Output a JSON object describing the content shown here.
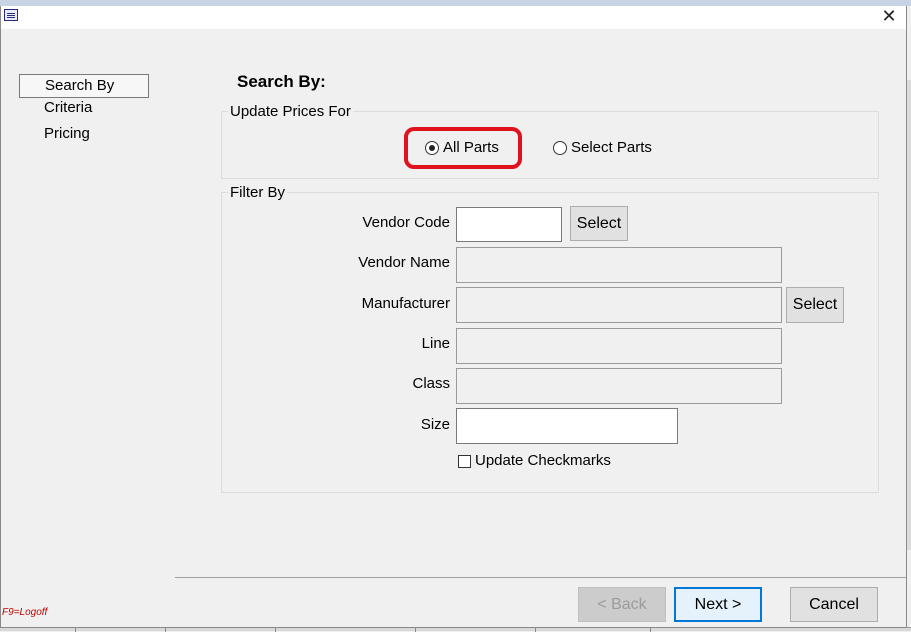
{
  "nav": {
    "items": [
      {
        "label": "Search By",
        "selected": true
      },
      {
        "label": "Criteria",
        "selected": false
      },
      {
        "label": "Pricing",
        "selected": false
      }
    ]
  },
  "heading": "Search By:",
  "update_prices": {
    "group_label": "Update Prices For",
    "options": [
      {
        "label": "All Parts",
        "checked": true
      },
      {
        "label": "Select Parts",
        "checked": false
      }
    ]
  },
  "filter": {
    "group_label": "Filter By",
    "vendor_code_label": "Vendor Code",
    "vendor_code_value": "",
    "vendor_name_label": "Vendor Name",
    "manufacturer_label": "Manufacturer",
    "line_label": "Line",
    "class_label": "Class",
    "size_label": "Size",
    "size_value": "",
    "select_label": "Select",
    "update_checkmarks_label": "Update Checkmarks",
    "update_checkmarks_checked": false
  },
  "buttons": {
    "back": "< Back",
    "next": "Next >",
    "cancel": "Cancel"
  },
  "status": {
    "logoff": "F9=Logoff"
  },
  "colors": {
    "highlight": "#e0121e",
    "logoff_text": "#c00000",
    "primary_button_border": "#0078d7"
  },
  "icons": {
    "window": "app-window-icon",
    "close": "close-icon"
  }
}
